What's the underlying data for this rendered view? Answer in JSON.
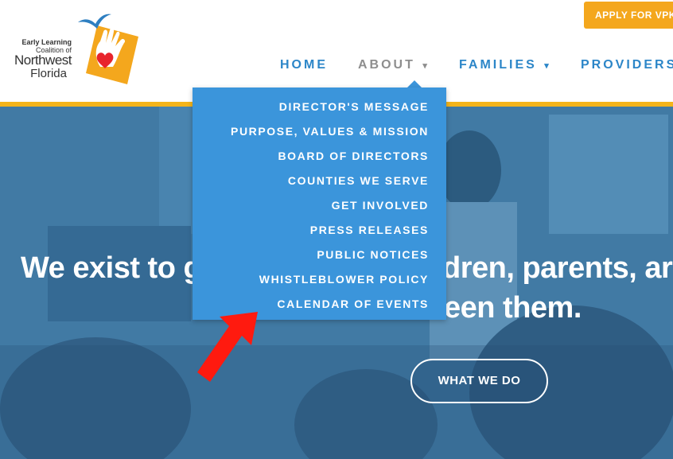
{
  "logo": {
    "line1": "Early Learning",
    "line2": "Coalition of",
    "line3": "Northwest",
    "line4": "Florida"
  },
  "header": {
    "apply_label": "APPLY FOR VPK",
    "accent_color": "#f4b41a",
    "nav": {
      "home": "HOME",
      "about": "ABOUT",
      "families": "FAMILIES",
      "providers": "PROVIDERS",
      "caret": "▾"
    }
  },
  "dropdown": {
    "items": [
      "DIRECTOR'S MESSAGE",
      "PURPOSE, VALUES & MISSION",
      "BOARD OF DIRECTORS",
      "COUNTIES WE SERVE",
      "GET INVOLVED",
      "PRESS RELEASES",
      "PUBLIC NOTICES",
      "WHISTLEBLOWER POLICY",
      "CALENDAR OF EVENTS"
    ],
    "color": "#3b95db"
  },
  "hero": {
    "headline_left": "We exist to g",
    "headline_right": "dren, parents, ar",
    "headline_line2": "een them.",
    "cta_label": "WHAT WE DO"
  },
  "annotation": {
    "arrow_color": "#ff0000",
    "arrow_icon": "red-arrow-icon"
  }
}
